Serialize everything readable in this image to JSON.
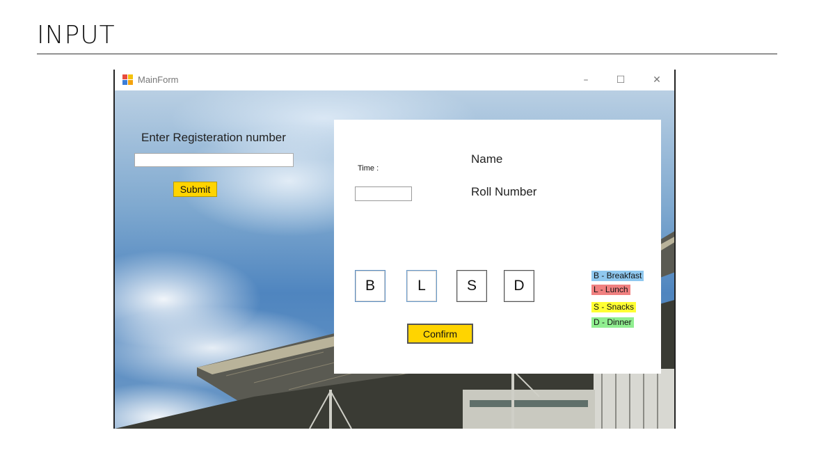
{
  "slide": {
    "heading": "INPUT"
  },
  "window": {
    "title": "MainForm",
    "controls": {
      "minimize": "–",
      "maximize": "☐",
      "close": "✕"
    }
  },
  "registration": {
    "label": "Enter Registeration number",
    "input_value": "",
    "submit_label": "Submit"
  },
  "panel": {
    "time_label": "Time :",
    "time_value": "",
    "name_label": "Name",
    "roll_label": "Roll Number",
    "meal_buttons": [
      "B",
      "L",
      "S",
      "D"
    ],
    "confirm_label": "Confirm",
    "legend": [
      {
        "text": "B - Breakfast",
        "color": "#8fc8ef"
      },
      {
        "text": "L - Lunch",
        "color": "#f08080"
      },
      {
        "text": "S - Snacks",
        "color": "#ffff33"
      },
      {
        "text": "D - Dinner",
        "color": "#90ee90"
      }
    ]
  },
  "colors": {
    "button_accent": "#ffd400"
  }
}
